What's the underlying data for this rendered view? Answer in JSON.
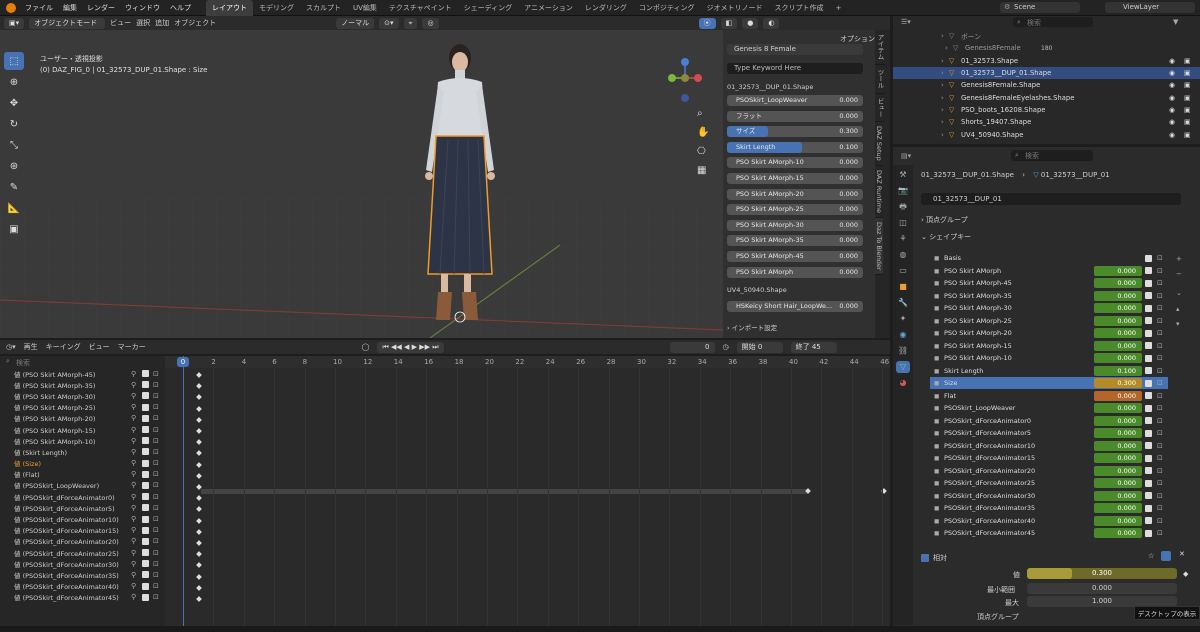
{
  "menu": {
    "items": [
      "ファイル",
      "編集",
      "レンダー",
      "ウィンドウ",
      "ヘルプ"
    ],
    "workspaces": [
      "レイアウト",
      "モデリング",
      "スカルプト",
      "UV編集",
      "テクスチャペイント",
      "シェーディング",
      "アニメーション",
      "レンダリング",
      "コンポジティング",
      "ジオメトリノード",
      "スクリプト作成",
      "+"
    ],
    "scene": "Scene",
    "viewlayer": "ViewLayer"
  },
  "viewport_header": {
    "mode": "オブジェクトモード",
    "items": [
      "ビュー",
      "選択",
      "追加",
      "オブジェクト"
    ],
    "orientation": "ノーマル",
    "options": "オプション"
  },
  "viewport": {
    "title": "ユーザー・透視投影",
    "subtitle": "(0) DAZ_FIG_0 | 01_32573_DUP_01.Shape : Size"
  },
  "npanel": {
    "figure": "Genesis 8 Female",
    "keyword_placeholder": "Type Keyword Here",
    "object": "01_32573__DUP_01.Shape",
    "sliders": [
      {
        "label": "PSOSkirt_LoopWeaver",
        "value": "0.000",
        "fill": 0
      },
      {
        "label": "フラット",
        "value": "0.000",
        "fill": 0
      },
      {
        "label": "サイズ",
        "value": "0.300",
        "fill": 0.3
      },
      {
        "label": "Skirt Length",
        "value": "0.100",
        "fill": 0.55
      },
      {
        "label": "PSO Skirt AMorph-10",
        "value": "0.000",
        "fill": 0
      },
      {
        "label": "PSO Skirt AMorph-15",
        "value": "0.000",
        "fill": 0
      },
      {
        "label": "PSO Skirt AMorph-20",
        "value": "0.000",
        "fill": 0
      },
      {
        "label": "PSO Skirt AMorph-25",
        "value": "0.000",
        "fill": 0
      },
      {
        "label": "PSO Skirt AMorph-30",
        "value": "0.000",
        "fill": 0
      },
      {
        "label": "PSO Skirt AMorph-35",
        "value": "0.000",
        "fill": 0
      },
      {
        "label": "PSO Skirt AMorph-45",
        "value": "0.000",
        "fill": 0
      },
      {
        "label": "PSO Skirt AMorph",
        "value": "0.000",
        "fill": 0
      }
    ],
    "shape2": "UV4_50940.Shape",
    "slider2": {
      "label": "HSKeicy Short Hair_LoopWe...",
      "value": "0.000"
    },
    "import": "インポート設定",
    "tabs": [
      "アイテム",
      "ツール",
      "ビュー",
      "DAZ Setup",
      "DAZ Runtime",
      "Daz To Blender"
    ]
  },
  "timeline": {
    "header": [
      "再生",
      "キーイング",
      "ビュー",
      "マーカー"
    ],
    "current": "0",
    "start_label": "開始",
    "start": "0",
    "end_label": "終了",
    "end": "45",
    "search_placeholder": "検索",
    "ticks": [
      "0",
      "2",
      "4",
      "6",
      "8",
      "10",
      "12",
      "14",
      "16",
      "18",
      "20",
      "22",
      "24",
      "26",
      "28",
      "30",
      "32",
      "34",
      "36",
      "38",
      "40",
      "42",
      "44",
      "46"
    ],
    "channels": [
      "値 (PSO Skirt AMorph-45)",
      "値 (PSO Skirt AMorph-35)",
      "値 (PSO Skirt AMorph-30)",
      "値 (PSO Skirt AMorph-25)",
      "値 (PSO Skirt AMorph-20)",
      "値 (PSO Skirt AMorph-15)",
      "値 (PSO Skirt AMorph-10)",
      "値 (Skirt Length)",
      "値 (Size)",
      "値 (Flat)",
      "値 (PSOSkirt_LoopWeaver)",
      "値 (PSOSkirt_dForceAnimator0)",
      "値 (PSOSkirt_dForceAnimator5)",
      "値 (PSOSkirt_dForceAnimator10)",
      "値 (PSOSkirt_dForceAnimator15)",
      "値 (PSOSkirt_dForceAnimator20)",
      "値 (PSOSkirt_dForceAnimator25)",
      "値 (PSOSkirt_dForceAnimator30)",
      "値 (PSOSkirt_dForceAnimator35)",
      "値 (PSOSkirt_dForceAnimator40)",
      "値 (PSOSkirt_dForceAnimator45)"
    ]
  },
  "outliner": {
    "search_placeholder": "検索",
    "rows": [
      "ボーン",
      "Genesis8Female",
      "01_32573.Shape",
      "01_32573__DUP_01.Shape",
      "Genesis8Female.Shape",
      "Genesis8FemaleEyelashes.Shape",
      "PSO_boots_16208.Shape",
      "Shorts_19407.Shape",
      "UV4_50940.Shape"
    ],
    "badge": "180"
  },
  "properties": {
    "search_placeholder": "検索",
    "breadcrumb_obj": "01_32573__DUP_01.Shape",
    "breadcrumb_mesh": "01_32573__DUP_01",
    "mesh_name": "01_32573__DUP_01",
    "vgroups": "頂点グループ",
    "shapekeys": "シェイプキー",
    "keys": [
      {
        "name": "Basis",
        "value": ""
      },
      {
        "name": "PSO Skirt AMorph",
        "value": "0.000"
      },
      {
        "name": "PSO Skirt AMorph-45",
        "value": "0.000"
      },
      {
        "name": "PSO Skirt AMorph-35",
        "value": "0.000"
      },
      {
        "name": "PSO Skirt AMorph-30",
        "value": "0.000"
      },
      {
        "name": "PSO Skirt AMorph-25",
        "value": "0.000"
      },
      {
        "name": "PSO Skirt AMorph-20",
        "value": "0.000"
      },
      {
        "name": "PSO Skirt AMorph-15",
        "value": "0.000"
      },
      {
        "name": "PSO Skirt AMorph-10",
        "value": "0.000"
      },
      {
        "name": "Skirt Length",
        "value": "0.100"
      },
      {
        "name": "Size",
        "value": "0.300"
      },
      {
        "name": "Flat",
        "value": "0.000"
      },
      {
        "name": "PSOSkirt_LoopWeaver",
        "value": "0.000"
      },
      {
        "name": "PSOSkirt_dForceAnimator0",
        "value": "0.000"
      },
      {
        "name": "PSOSkirt_dForceAnimator5",
        "value": "0.000"
      },
      {
        "name": "PSOSkirt_dForceAnimator10",
        "value": "0.000"
      },
      {
        "name": "PSOSkirt_dForceAnimator15",
        "value": "0.000"
      },
      {
        "name": "PSOSkirt_dForceAnimator20",
        "value": "0.000"
      },
      {
        "name": "PSOSkirt_dForceAnimator25",
        "value": "0.000"
      },
      {
        "name": "PSOSkirt_dForceAnimator30",
        "value": "0.000"
      },
      {
        "name": "PSOSkirt_dForceAnimator35",
        "value": "0.000"
      },
      {
        "name": "PSOSkirt_dForceAnimator40",
        "value": "0.000"
      },
      {
        "name": "PSOSkirt_dForceAnimator45",
        "value": "0.000"
      }
    ],
    "relative": "相対",
    "value_label": "値",
    "value": "0.300",
    "min_label": "最小範囲",
    "min": "0.000",
    "max_label": "最大",
    "max": "1.000",
    "vgroup_label": "頂点グループ"
  },
  "tooltip": "デスクトップの表示",
  "colors": {
    "accent": "#4772b3",
    "keyed": "#4b8a2a",
    "orange": "#e8a030"
  }
}
